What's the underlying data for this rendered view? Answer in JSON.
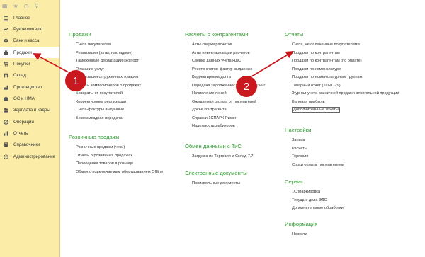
{
  "sidebar": {
    "top_icons": [
      "grid-icon",
      "star-icon",
      "history-icon",
      "search-icon"
    ],
    "items": [
      {
        "label": "Главное",
        "icon": "list-icon"
      },
      {
        "label": "Руководителю",
        "icon": "chart-line-icon"
      },
      {
        "label": "Банк и касса",
        "icon": "bank-icon"
      },
      {
        "label": "Продажи",
        "icon": "cash-register-icon",
        "active": true
      },
      {
        "label": "Покупки",
        "icon": "cart-icon"
      },
      {
        "label": "Склад",
        "icon": "warehouse-icon"
      },
      {
        "label": "Производство",
        "icon": "factory-icon"
      },
      {
        "label": "ОС и НМА",
        "icon": "building-icon"
      },
      {
        "label": "Зарплата и кадры",
        "icon": "people-icon"
      },
      {
        "label": "Операции",
        "icon": "operations-icon"
      },
      {
        "label": "Отчеты",
        "icon": "reports-icon"
      },
      {
        "label": "Справочники",
        "icon": "book-icon"
      },
      {
        "label": "Администрирование",
        "icon": "gear-icon"
      }
    ]
  },
  "columns": [
    {
      "sections": [
        {
          "title": "Продажи",
          "items": [
            "Счета покупателям",
            "Реализация (акты, накладные)",
            "Таможенные декларации (экспорт)",
            "Оказание услуг",
            "Реализация отгруженных товаров",
            "Отчеты комиссионеров о продажах",
            "Возвраты от покупателей",
            "Корректировка реализации",
            "Счета-фактуры выданные",
            "Безвозмездная передача"
          ]
        },
        {
          "title": "Розничные продажи",
          "items": [
            "Розничные продажи (чеки)",
            "Отчеты о розничных продажах",
            "Переоценка товаров в рознице",
            "Обмен с подключаемым оборудованием Offline"
          ]
        }
      ]
    },
    {
      "sections": [
        {
          "title": "Расчеты с контрагентами",
          "items": [
            "Акты сверки расчетов",
            "Акты инвентаризации расчетов",
            "Сверка данных учета НДС",
            "Реестр счетов-фактур выданных",
            "Корректировка долга",
            "Передача задолженности на факторинг",
            "Начисление пеней",
            "Ожидаемая оплата от покупателей",
            "Досье контрагента",
            "Справки 1СПАРК Риски",
            "Надежность дебиторов"
          ]
        },
        {
          "title": "Обмен данными с ТиС",
          "items": [
            "Загрузка из Торговля и Склад 7.7"
          ]
        },
        {
          "title": "Электронные документы",
          "items": [
            "Произвольные документы"
          ]
        }
      ]
    },
    {
      "sections": [
        {
          "title": "Отчеты",
          "items": [
            "Счета, не оплаченные покупателями",
            "Продажи по контрагентам",
            "Продажи по контрагентам (по оплате)",
            "Продажи по номенклатуре",
            "Продажи по номенклатурным группам",
            "Товарный отчет (ТОРГ-29)",
            "Журнал учета розничной продажи алкогольной продукции",
            "Валовая прибыль",
            "Дополнительные отчеты"
          ],
          "boxed_index": 8
        },
        {
          "title": "Настройки",
          "items": [
            "Запасы",
            "Расчеты",
            "Торговля",
            "Сроки оплаты покупателями"
          ]
        },
        {
          "title": "Сервис",
          "items": [
            "1С:Маркировка",
            "Текущие дела ЭДО",
            "Дополнительные обработки"
          ]
        },
        {
          "title": "Информация",
          "items": [
            "Новости"
          ]
        }
      ]
    }
  ],
  "markers": [
    {
      "label": "1",
      "color": "#c9191e"
    },
    {
      "label": "2",
      "color": "#c9191e"
    }
  ],
  "colors": {
    "sidebar_bg": "#fbeda7",
    "section_title": "#2f9a2f",
    "marker": "#c9191e"
  }
}
